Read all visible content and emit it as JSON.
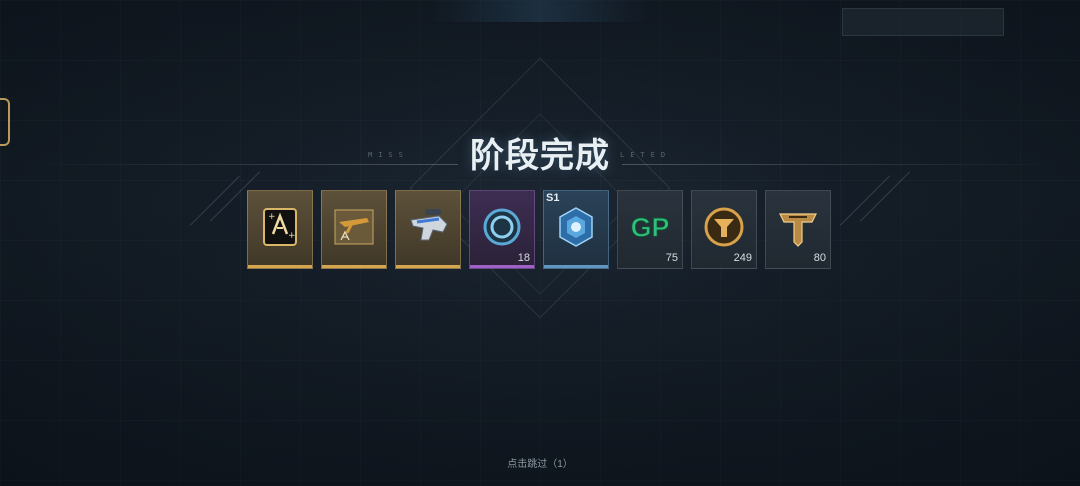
{
  "title": "阶段完成",
  "deco_left": "MISS",
  "deco_right": "LETED",
  "rewards": [
    {
      "name": "upgrade-card-icon",
      "rarity": "gold",
      "count": "",
      "tag": ""
    },
    {
      "name": "weapon-blueprint-icon",
      "rarity": "gold",
      "count": "",
      "tag": ""
    },
    {
      "name": "weapon-skin-icon",
      "rarity": "gold",
      "count": "",
      "tag": ""
    },
    {
      "name": "ring-token-icon",
      "rarity": "purple",
      "count": "18",
      "tag": ""
    },
    {
      "name": "crystal-core-icon",
      "rarity": "blue",
      "count": "",
      "tag": "S1"
    },
    {
      "name": "gp-currency-icon",
      "rarity": "grey",
      "count": "75",
      "tag": ""
    },
    {
      "name": "gold-badge-icon",
      "rarity": "grey",
      "count": "249",
      "tag": ""
    },
    {
      "name": "tier-emblem-icon",
      "rarity": "grey",
      "count": "80",
      "tag": ""
    }
  ],
  "gp_text": "GP",
  "skip_text": "点击跳过（1）",
  "colors": {
    "gold": "#d6a64e",
    "purple": "#a060c8",
    "blue": "#5f97c0",
    "gp": "#2fbf7a"
  }
}
